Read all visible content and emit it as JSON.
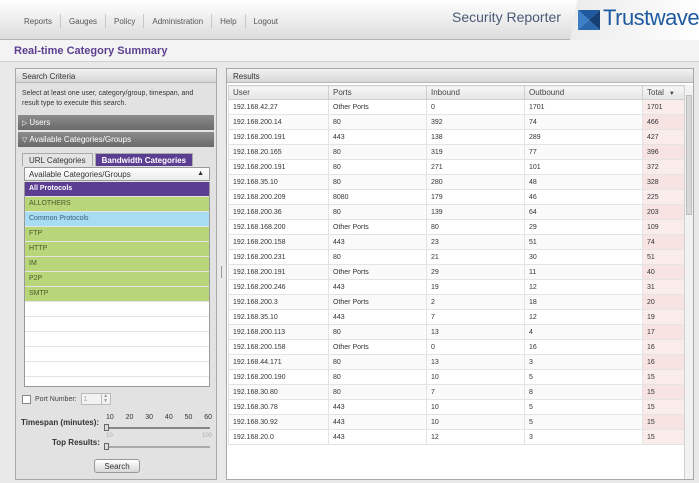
{
  "nav": {
    "items": [
      "Reports",
      "Gauges",
      "Policy",
      "Administration",
      "Help",
      "Logout"
    ],
    "app_title": "Security Reporter",
    "brand": "Trustwave",
    "brand_mark": "®"
  },
  "page_title": "Real-time Category Summary",
  "search": {
    "header": "Search Criteria",
    "instructions": "Select at least one user, category/group, timespan, and result type to execute this search.",
    "users_label": "Users",
    "available_label": "Available Categories/Groups",
    "tabs": [
      "URL Categories",
      "Bandwidth Categories"
    ],
    "dropdown_value": "Available Categories/Groups",
    "categories": [
      {
        "label": "All Protocols",
        "style": "purple"
      },
      {
        "label": "ALLOTHERS",
        "style": "green"
      },
      {
        "label": "Common Protocols",
        "style": "blue"
      },
      {
        "label": "FTP",
        "style": "green"
      },
      {
        "label": "HTTP",
        "style": "green"
      },
      {
        "label": "IM",
        "style": "green"
      },
      {
        "label": "P2P",
        "style": "green"
      },
      {
        "label": "SMTP",
        "style": "green"
      }
    ],
    "port_number_label": "Port Number:",
    "port_number_value": "1",
    "timespan_label": "Timespan (minutes):",
    "timespan_ticks": [
      "10",
      "20",
      "30",
      "40",
      "50",
      "60"
    ],
    "timespan_value": 10,
    "top_results_label": "Top Results:",
    "top_results_ticks": [
      "10",
      "100"
    ],
    "top_results_value": 10,
    "search_button": "Search"
  },
  "results": {
    "header": "Results",
    "columns": [
      "User",
      "Ports",
      "Inbound",
      "Outbound",
      "Total"
    ],
    "sort_indicator": "▼",
    "rows": [
      [
        "192.168.42.27",
        "Other Ports",
        "0",
        "1701",
        "1701"
      ],
      [
        "192.168.200.14",
        "80",
        "392",
        "74",
        "466"
      ],
      [
        "192.168.200.191",
        "443",
        "138",
        "289",
        "427"
      ],
      [
        "192.168.20.165",
        "80",
        "319",
        "77",
        "396"
      ],
      [
        "192.168.200.191",
        "80",
        "271",
        "101",
        "372"
      ],
      [
        "192.168.35.10",
        "80",
        "280",
        "48",
        "328"
      ],
      [
        "192.168.200.209",
        "8080",
        "179",
        "46",
        "225"
      ],
      [
        "192.168.200.36",
        "80",
        "139",
        "64",
        "203"
      ],
      [
        "192.168.168.200",
        "Other Ports",
        "80",
        "29",
        "109"
      ],
      [
        "192.168.200.158",
        "443",
        "23",
        "51",
        "74"
      ],
      [
        "192.168.200.231",
        "80",
        "21",
        "30",
        "51"
      ],
      [
        "192.168.200.191",
        "Other Ports",
        "29",
        "11",
        "40"
      ],
      [
        "192.168.200.246",
        "443",
        "19",
        "12",
        "31"
      ],
      [
        "192.168.200.3",
        "Other Ports",
        "2",
        "18",
        "20"
      ],
      [
        "192.168.35.10",
        "443",
        "7",
        "12",
        "19"
      ],
      [
        "192.168.200.113",
        "80",
        "13",
        "4",
        "17"
      ],
      [
        "192.168.200.158",
        "Other Ports",
        "0",
        "16",
        "16"
      ],
      [
        "192.168.44.171",
        "80",
        "13",
        "3",
        "16"
      ],
      [
        "192.168.200.190",
        "80",
        "10",
        "5",
        "15"
      ],
      [
        "192.168.30.80",
        "80",
        "7",
        "8",
        "15"
      ],
      [
        "192.168.30.78",
        "443",
        "10",
        "5",
        "15"
      ],
      [
        "192.168.30.92",
        "443",
        "10",
        "5",
        "15"
      ],
      [
        "192.168.20.0",
        "443",
        "12",
        "3",
        "15"
      ]
    ]
  },
  "colors": {
    "accent_purple": "#5b3d92",
    "category_green": "#b8d57a",
    "category_blue": "#a7dcf3",
    "brand_blue": "#1f5aa0"
  }
}
